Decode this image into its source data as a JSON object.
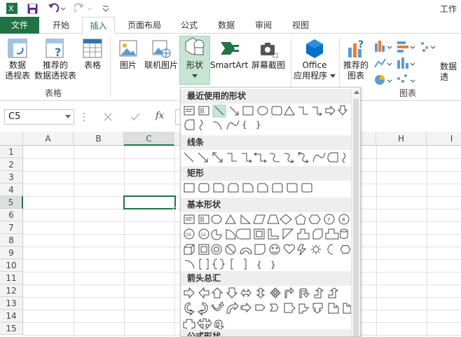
{
  "title": "工作",
  "colors": {
    "accent": "#217346",
    "selected_bg": "#c6e5d3"
  },
  "tabs": [
    {
      "label": "文件",
      "name": "tab-file"
    },
    {
      "label": "开始",
      "name": "tab-home"
    },
    {
      "label": "插入",
      "name": "tab-insert"
    },
    {
      "label": "页面布局",
      "name": "tab-page-layout"
    },
    {
      "label": "公式",
      "name": "tab-formulas"
    },
    {
      "label": "数据",
      "name": "tab-data"
    },
    {
      "label": "审阅",
      "name": "tab-review"
    },
    {
      "label": "视图",
      "name": "tab-view"
    }
  ],
  "ribbon": {
    "pivot_line1": "数据",
    "pivot_line2": "透视表",
    "rec_pivot_line1": "推荐的",
    "rec_pivot_line2": "数据透视表",
    "table": "表格",
    "group_tables": "表格",
    "picture": "图片",
    "online_picture": "联机图片",
    "shapes": "形状",
    "smartart": "SmartArt",
    "screenshot": "屏幕截图",
    "office_line1": "Office",
    "office_line2": "应用程序",
    "rec_chart_line1": "推荐的",
    "rec_chart_line2": "图表",
    "data_partial": "数据透",
    "group_charts": "图表"
  },
  "formula_bar": {
    "name_box": "C5",
    "fx": "fx"
  },
  "grid": {
    "columns": [
      "A",
      "B",
      "C",
      "D",
      "E",
      "F",
      "G",
      "H",
      "I"
    ],
    "rows": [
      "1",
      "2",
      "3",
      "4",
      "5",
      "6",
      "7",
      "8",
      "9",
      "10",
      "11",
      "12",
      "13",
      "14",
      "15"
    ],
    "active_cell": "C5"
  },
  "shapes_menu": {
    "recent": "最近使用的形状",
    "lines": "线条",
    "rectangles": "矩形",
    "basic": "基本形状",
    "arrows": "箭头总汇",
    "formula": "公式形状"
  }
}
